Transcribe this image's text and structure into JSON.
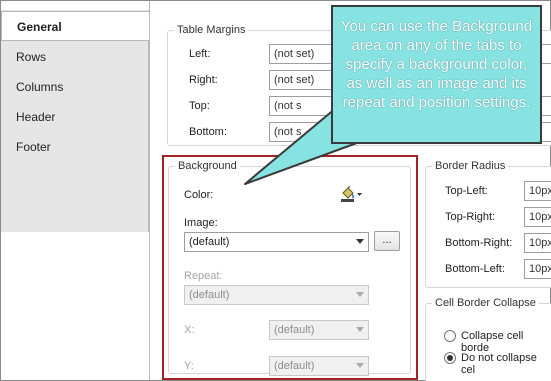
{
  "tabs": [
    {
      "label": "General",
      "active": true
    },
    {
      "label": "Rows",
      "active": false
    },
    {
      "label": "Columns",
      "active": false
    },
    {
      "label": "Header",
      "active": false
    },
    {
      "label": "Footer",
      "active": false
    }
  ],
  "table_margins": {
    "title": "Table Margins",
    "left_label": "Left:",
    "left_value": "(not set)",
    "right_label": "Right:",
    "right_value": "(not set)",
    "top_label": "Top:",
    "top_value": "(not s",
    "bottom_label": "Bottom:",
    "bottom_value": "(not s"
  },
  "background": {
    "title": "Background",
    "color_label": "Color:",
    "image_label": "Image:",
    "image_value": "(default)",
    "browse_label": "...",
    "repeat_label": "Repeat:",
    "repeat_value": "(default)",
    "x_label": "X:",
    "x_value": "(default)",
    "y_label": "Y:",
    "y_value": "(default)"
  },
  "border_radius": {
    "title": "Border Radius",
    "top_left_label": "Top-Left:",
    "top_left_value": "10px",
    "top_right_label": "Top-Right:",
    "top_right_value": "10px",
    "bottom_right_label": "Bottom-Right:",
    "bottom_right_value": "10px",
    "bottom_left_label": "Bottom-Left:",
    "bottom_left_value": "10px"
  },
  "cell_border_collapse": {
    "title": "Cell Border Collapse",
    "option_collapse": "Collapse cell borde",
    "option_no_collapse": "Do not collapse cel"
  },
  "callout": {
    "text": "You can use the Background area on any of the tabs to specify a background color, as well as an image and its repeat and position settings."
  },
  "colors": {
    "callout_fill": "#87e2e2",
    "highlight_border": "#a12323",
    "tab_strip": "#e6e6e6"
  }
}
